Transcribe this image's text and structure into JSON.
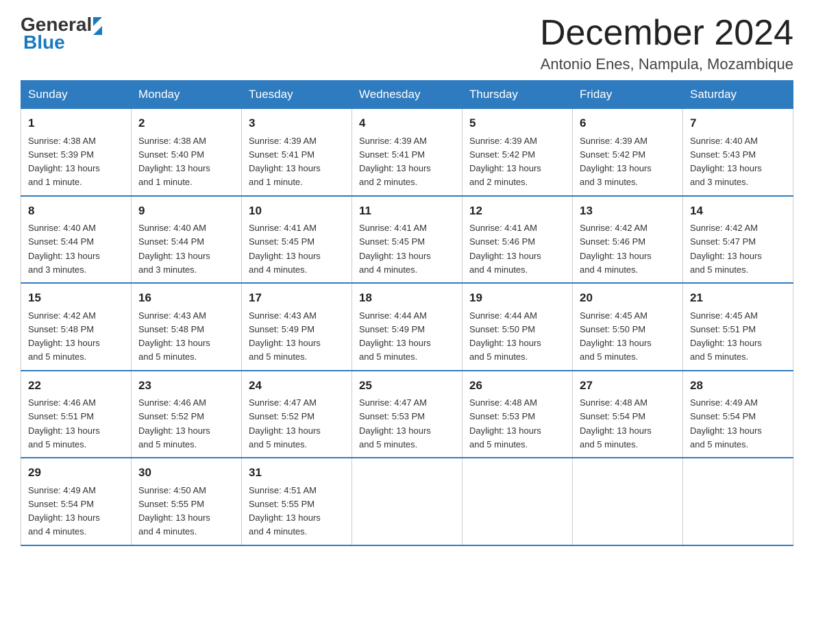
{
  "logo": {
    "text_general": "General",
    "text_blue": "Blue"
  },
  "header": {
    "title": "December 2024",
    "subtitle": "Antonio Enes, Nampula, Mozambique"
  },
  "days_of_week": [
    "Sunday",
    "Monday",
    "Tuesday",
    "Wednesday",
    "Thursday",
    "Friday",
    "Saturday"
  ],
  "weeks": [
    [
      {
        "day": "1",
        "sunrise": "4:38 AM",
        "sunset": "5:39 PM",
        "daylight": "13 hours and 1 minute."
      },
      {
        "day": "2",
        "sunrise": "4:38 AM",
        "sunset": "5:40 PM",
        "daylight": "13 hours and 1 minute."
      },
      {
        "day": "3",
        "sunrise": "4:39 AM",
        "sunset": "5:41 PM",
        "daylight": "13 hours and 1 minute."
      },
      {
        "day": "4",
        "sunrise": "4:39 AM",
        "sunset": "5:41 PM",
        "daylight": "13 hours and 2 minutes."
      },
      {
        "day": "5",
        "sunrise": "4:39 AM",
        "sunset": "5:42 PM",
        "daylight": "13 hours and 2 minutes."
      },
      {
        "day": "6",
        "sunrise": "4:39 AM",
        "sunset": "5:42 PM",
        "daylight": "13 hours and 3 minutes."
      },
      {
        "day": "7",
        "sunrise": "4:40 AM",
        "sunset": "5:43 PM",
        "daylight": "13 hours and 3 minutes."
      }
    ],
    [
      {
        "day": "8",
        "sunrise": "4:40 AM",
        "sunset": "5:44 PM",
        "daylight": "13 hours and 3 minutes."
      },
      {
        "day": "9",
        "sunrise": "4:40 AM",
        "sunset": "5:44 PM",
        "daylight": "13 hours and 3 minutes."
      },
      {
        "day": "10",
        "sunrise": "4:41 AM",
        "sunset": "5:45 PM",
        "daylight": "13 hours and 4 minutes."
      },
      {
        "day": "11",
        "sunrise": "4:41 AM",
        "sunset": "5:45 PM",
        "daylight": "13 hours and 4 minutes."
      },
      {
        "day": "12",
        "sunrise": "4:41 AM",
        "sunset": "5:46 PM",
        "daylight": "13 hours and 4 minutes."
      },
      {
        "day": "13",
        "sunrise": "4:42 AM",
        "sunset": "5:46 PM",
        "daylight": "13 hours and 4 minutes."
      },
      {
        "day": "14",
        "sunrise": "4:42 AM",
        "sunset": "5:47 PM",
        "daylight": "13 hours and 5 minutes."
      }
    ],
    [
      {
        "day": "15",
        "sunrise": "4:42 AM",
        "sunset": "5:48 PM",
        "daylight": "13 hours and 5 minutes."
      },
      {
        "day": "16",
        "sunrise": "4:43 AM",
        "sunset": "5:48 PM",
        "daylight": "13 hours and 5 minutes."
      },
      {
        "day": "17",
        "sunrise": "4:43 AM",
        "sunset": "5:49 PM",
        "daylight": "13 hours and 5 minutes."
      },
      {
        "day": "18",
        "sunrise": "4:44 AM",
        "sunset": "5:49 PM",
        "daylight": "13 hours and 5 minutes."
      },
      {
        "day": "19",
        "sunrise": "4:44 AM",
        "sunset": "5:50 PM",
        "daylight": "13 hours and 5 minutes."
      },
      {
        "day": "20",
        "sunrise": "4:45 AM",
        "sunset": "5:50 PM",
        "daylight": "13 hours and 5 minutes."
      },
      {
        "day": "21",
        "sunrise": "4:45 AM",
        "sunset": "5:51 PM",
        "daylight": "13 hours and 5 minutes."
      }
    ],
    [
      {
        "day": "22",
        "sunrise": "4:46 AM",
        "sunset": "5:51 PM",
        "daylight": "13 hours and 5 minutes."
      },
      {
        "day": "23",
        "sunrise": "4:46 AM",
        "sunset": "5:52 PM",
        "daylight": "13 hours and 5 minutes."
      },
      {
        "day": "24",
        "sunrise": "4:47 AM",
        "sunset": "5:52 PM",
        "daylight": "13 hours and 5 minutes."
      },
      {
        "day": "25",
        "sunrise": "4:47 AM",
        "sunset": "5:53 PM",
        "daylight": "13 hours and 5 minutes."
      },
      {
        "day": "26",
        "sunrise": "4:48 AM",
        "sunset": "5:53 PM",
        "daylight": "13 hours and 5 minutes."
      },
      {
        "day": "27",
        "sunrise": "4:48 AM",
        "sunset": "5:54 PM",
        "daylight": "13 hours and 5 minutes."
      },
      {
        "day": "28",
        "sunrise": "4:49 AM",
        "sunset": "5:54 PM",
        "daylight": "13 hours and 5 minutes."
      }
    ],
    [
      {
        "day": "29",
        "sunrise": "4:49 AM",
        "sunset": "5:54 PM",
        "daylight": "13 hours and 4 minutes."
      },
      {
        "day": "30",
        "sunrise": "4:50 AM",
        "sunset": "5:55 PM",
        "daylight": "13 hours and 4 minutes."
      },
      {
        "day": "31",
        "sunrise": "4:51 AM",
        "sunset": "5:55 PM",
        "daylight": "13 hours and 4 minutes."
      },
      null,
      null,
      null,
      null
    ]
  ],
  "labels": {
    "sunrise_prefix": "Sunrise: ",
    "sunset_prefix": "Sunset: ",
    "daylight_prefix": "Daylight: "
  }
}
